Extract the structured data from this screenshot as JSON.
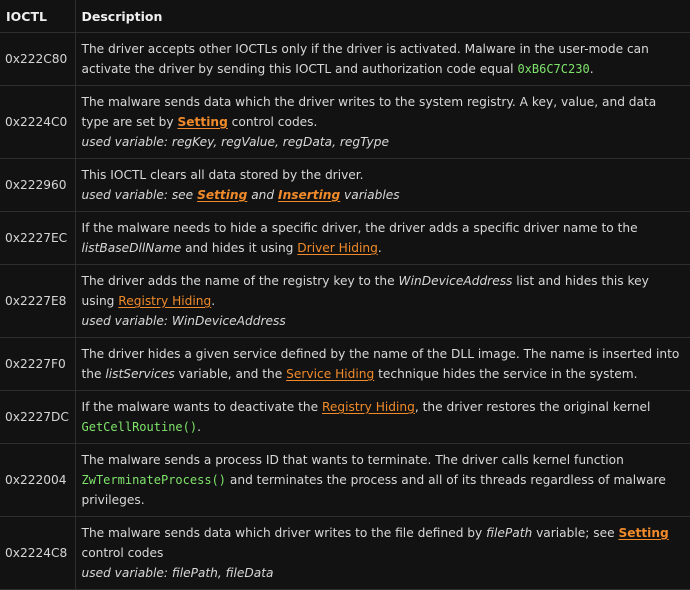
{
  "header": {
    "ioctl": "IOCTL",
    "description": "Description"
  },
  "rows": [
    {
      "ioctl": "0x222C80",
      "t1": "The driver accepts other IOCTLs only if the driver is activated. Malware in the user-mode can activate the driver by sending this IOCTL and authorization code equal ",
      "code": "0xB6C7C230",
      "t2": "."
    },
    {
      "ioctl": "0x2224C0",
      "t1": "The malware sends data which the driver writes to the system registry. A key, value, and data type are set by ",
      "link": "Setting",
      "t2": " control codes.",
      "note": "used variable: regKey, regValue, regData, regType"
    },
    {
      "ioctl": "0x222960",
      "t1": "This IOCTL clears all data stored by the driver.",
      "note_a": "used variable: see ",
      "link_a": "Setting",
      "note_b": " and ",
      "link_b": "Inserting",
      "note_c": " variables"
    },
    {
      "ioctl": "0x2227EC",
      "t1": "If the malware needs to hide a specific driver, the driver adds a specific driver name to the ",
      "var": "listBaseDllName",
      "t2": " and hides it using ",
      "link": "Driver Hiding",
      "t3": "."
    },
    {
      "ioctl": "0x2227E8",
      "t1": "The driver adds the name of the registry key to the ",
      "var": "WinDeviceAddress",
      "t2": " list and hides this key using ",
      "link": "Registry Hiding",
      "t3": ".",
      "note": "used variable: WinDeviceAddress"
    },
    {
      "ioctl": "0x2227F0",
      "t1": "The driver hides a given service defined by the name of the DLL image. The name is inserted into the ",
      "var": "listServices",
      "t2": " variable, and the ",
      "link": "Service Hiding",
      "t3": " technique hides the service in the system."
    },
    {
      "ioctl": "0x2227DC",
      "t1": "If the malware wants to deactivate the ",
      "link": "Registry Hiding",
      "t2": ", the driver restores the original kernel ",
      "code": "GetCellRoutine()",
      "t3": "."
    },
    {
      "ioctl": "0x222004",
      "t1": "The malware sends a process ID that wants to terminate. The driver calls kernel function ",
      "code": "ZwTerminateProcess()",
      "t2": " and terminates the process and all of its threads regardless of malware privileges."
    },
    {
      "ioctl": "0x2224C8",
      "t1": "The malware sends data which driver writes to the file defined by ",
      "var": "filePath",
      "t2": " variable; see ",
      "link": "Setting",
      "t3": " control codes",
      "note": "used variable: filePath, fileData"
    }
  ]
}
